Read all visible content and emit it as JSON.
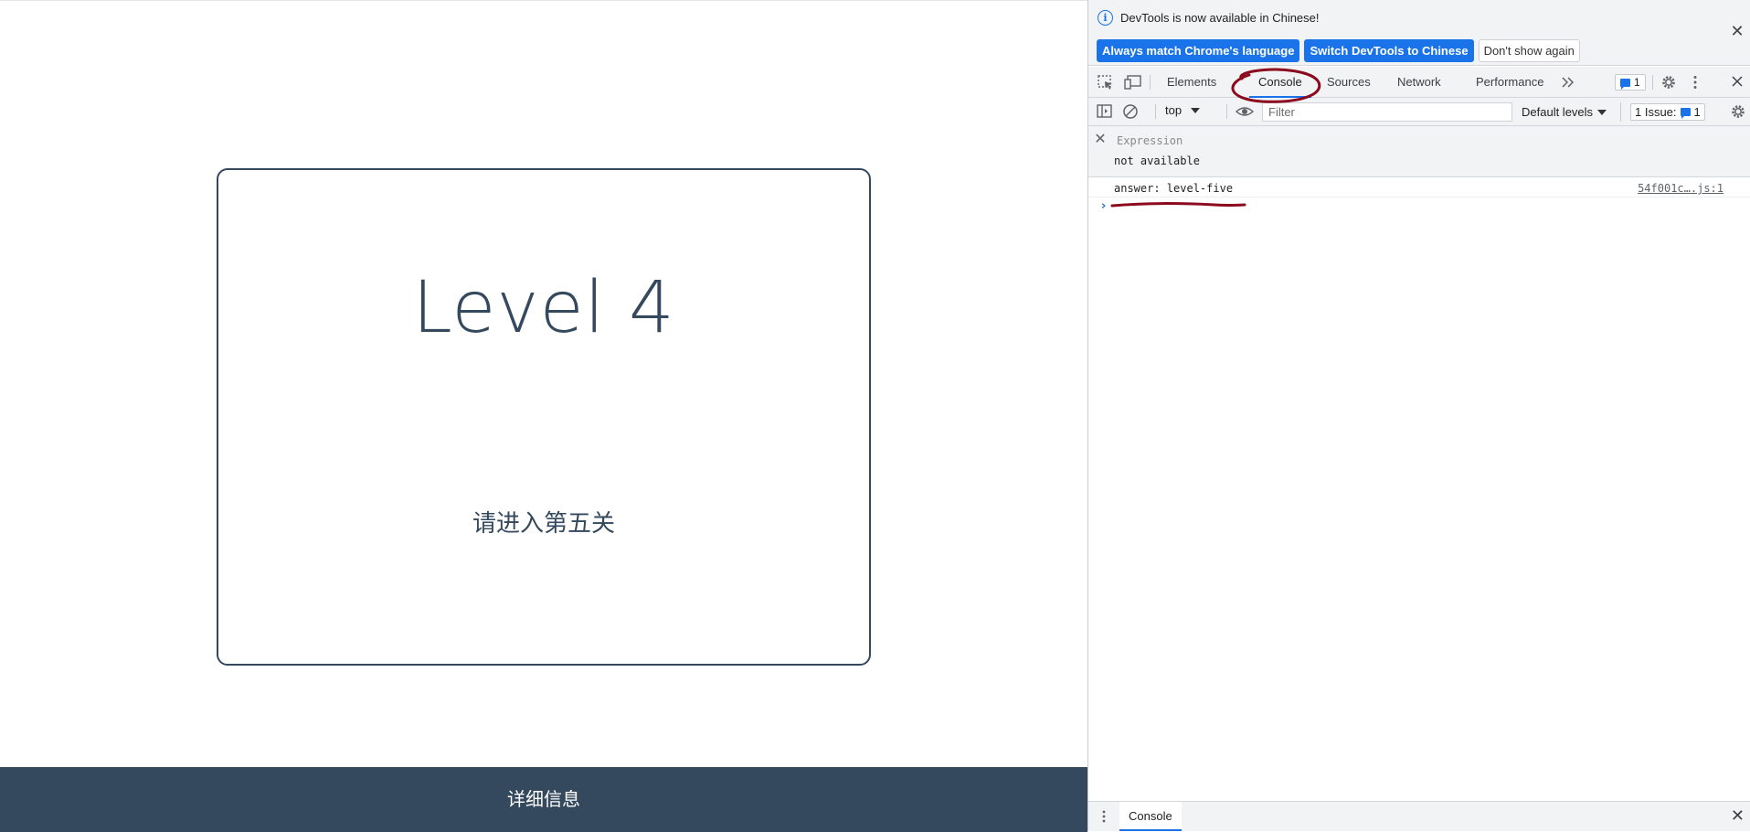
{
  "page": {
    "level_title": "Level 4",
    "level_text": "请进入第五关",
    "footer_label": "详细信息"
  },
  "devtools": {
    "infobar": {
      "message": "DevTools is now available in Chinese!",
      "buttons": [
        "Always match Chrome's language",
        "Switch DevTools to Chinese",
        "Don't show again"
      ]
    },
    "tabs": [
      "Elements",
      "Console",
      "Sources",
      "Network",
      "Performance"
    ],
    "active_tab": "Console",
    "message_badge_count": "1",
    "toolbar": {
      "context": "top",
      "filter_placeholder": "Filter",
      "levels": "Default levels",
      "issues_label": "1 Issue:",
      "issues_count": "1"
    },
    "console": {
      "expression_label": "Expression",
      "expression_value": "not available",
      "log_message": "answer: level-five",
      "log_source": "54f001c….js:1"
    },
    "drawer": {
      "tab": "Console"
    }
  },
  "colors": {
    "brand": "#34495e",
    "accent": "#1a73e8",
    "annotation": "#8b0a1e"
  }
}
